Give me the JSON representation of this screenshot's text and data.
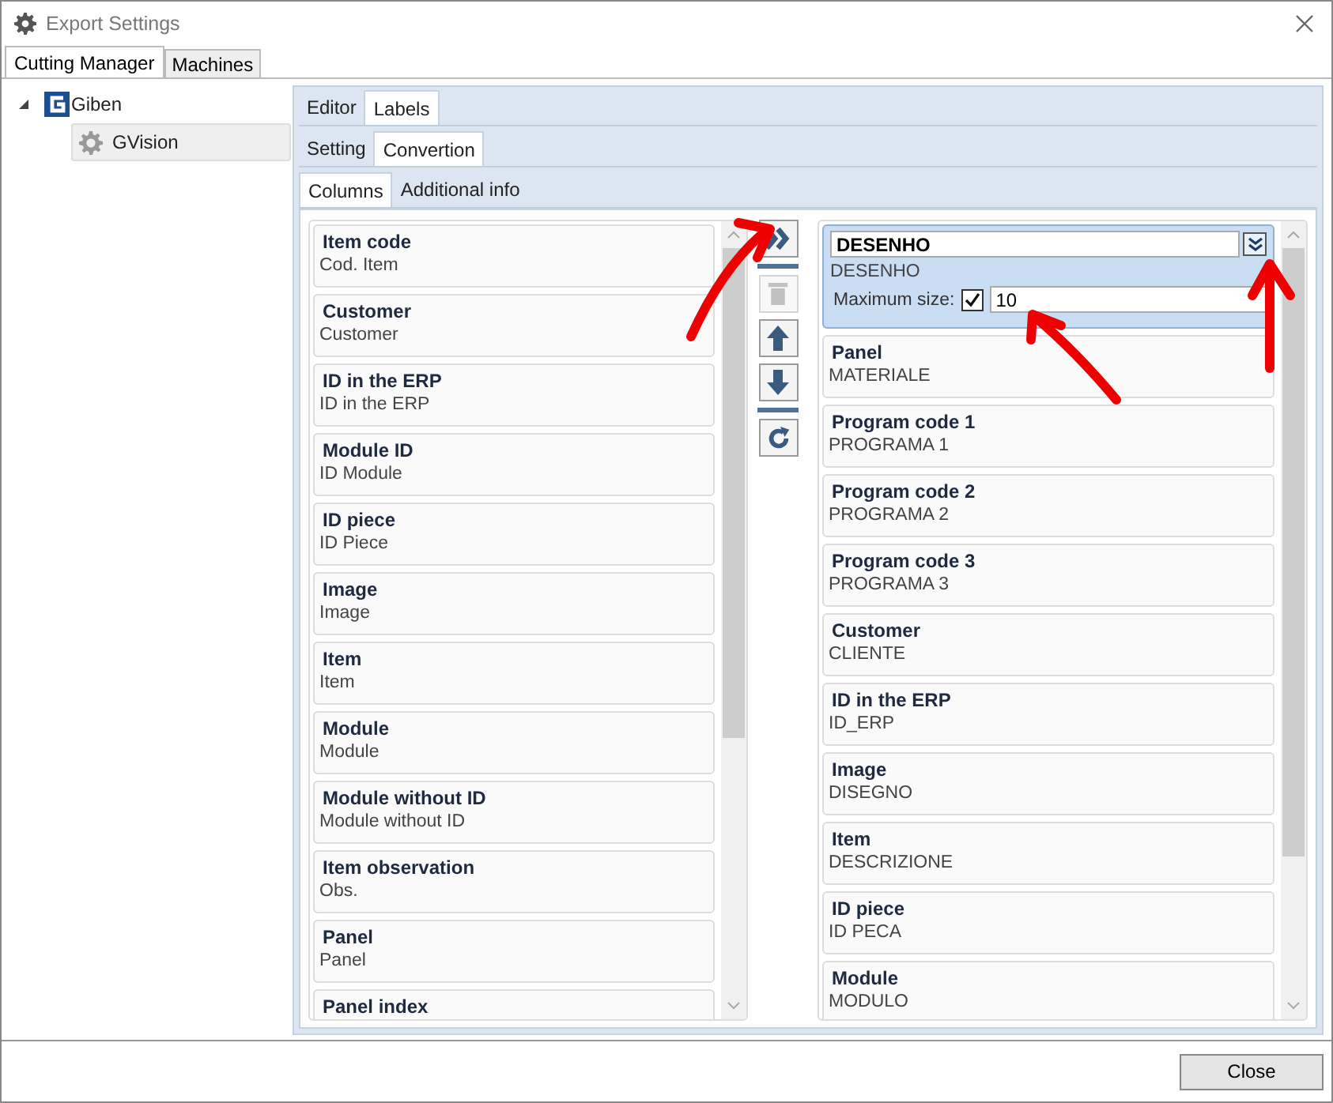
{
  "window": {
    "title": "Export Settings"
  },
  "top_tabs": [
    {
      "label": "Cutting Manager",
      "selected": true
    },
    {
      "label": "Machines",
      "selected": false
    }
  ],
  "tree": [
    {
      "label": "Giben",
      "expanded": true,
      "kind": "brand",
      "children": [
        {
          "label": "GVision",
          "kind": "gear",
          "selected": true
        }
      ]
    }
  ],
  "section_tabs": [
    {
      "label": "Editor",
      "selected": false
    },
    {
      "label": "Labels",
      "selected": true
    }
  ],
  "sub_tabs": [
    {
      "label": "Setting",
      "selected": false
    },
    {
      "label": "Convertion",
      "selected": true
    }
  ],
  "panel_tabs": [
    {
      "label": "Columns",
      "selected": true
    },
    {
      "label": "Additional info",
      "selected": false
    }
  ],
  "available_columns": [
    {
      "title": "Item code",
      "subtitle": "Cod. Item"
    },
    {
      "title": "Customer",
      "subtitle": "Customer"
    },
    {
      "title": "ID in the ERP",
      "subtitle": "ID in the ERP"
    },
    {
      "title": "Module ID",
      "subtitle": "ID Module"
    },
    {
      "title": "ID piece",
      "subtitle": "ID Piece"
    },
    {
      "title": "Image",
      "subtitle": "Image"
    },
    {
      "title": "Item",
      "subtitle": "Item"
    },
    {
      "title": "Module",
      "subtitle": "Module"
    },
    {
      "title": "Module without ID",
      "subtitle": "Module without ID"
    },
    {
      "title": "Item observation",
      "subtitle": "Obs."
    },
    {
      "title": "Panel",
      "subtitle": "Panel"
    },
    {
      "title": "Panel index"
    }
  ],
  "action_buttons": [
    {
      "kind": "add",
      "disabled": false
    },
    {
      "kind": "delete",
      "disabled": true
    },
    {
      "kind": "up",
      "disabled": false
    },
    {
      "kind": "down",
      "disabled": false
    },
    {
      "kind": "reset",
      "disabled": false
    }
  ],
  "selected_columns": [
    {
      "title": "DESENHO",
      "subtitle": "DESENHO",
      "selected": true,
      "max_size_label": "Maximum size:",
      "max_size_checked": true,
      "max_size": "10"
    },
    {
      "title": "Panel",
      "subtitle": "MATERIALE",
      "selected": false
    },
    {
      "title": "Program code 1",
      "subtitle": "PROGRAMA 1",
      "selected": false
    },
    {
      "title": "Program code 2",
      "subtitle": "PROGRAMA 2",
      "selected": false
    },
    {
      "title": "Program code 3",
      "subtitle": "PROGRAMA 3",
      "selected": false
    },
    {
      "title": "Customer",
      "subtitle": "CLIENTE",
      "selected": false
    },
    {
      "title": "ID in the ERP",
      "subtitle": "ID_ERP",
      "selected": false
    },
    {
      "title": "Image",
      "subtitle": "DISEGNO",
      "selected": false
    },
    {
      "title": "Item",
      "subtitle": "DESCRIZIONE",
      "selected": false
    },
    {
      "title": "ID piece",
      "subtitle": "ID PECA",
      "selected": false
    },
    {
      "title": "Module",
      "subtitle": "MODULO",
      "selected": false
    }
  ],
  "footer": {
    "close_button": "Close"
  }
}
